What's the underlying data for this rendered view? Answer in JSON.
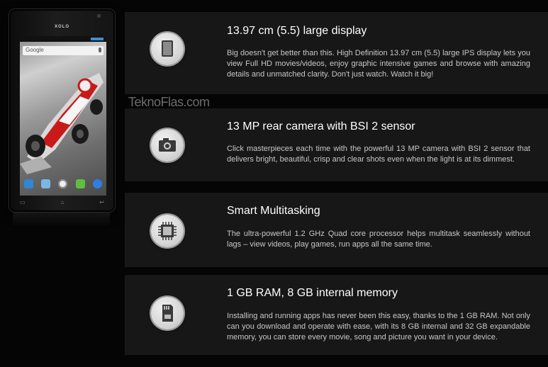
{
  "phone": {
    "brand": "XOLO",
    "search_label": "Google",
    "softkeys": [
      "▭",
      "⌂",
      "↩"
    ]
  },
  "watermark": "TeknoFlas.com",
  "features": [
    {
      "icon": "display-icon",
      "title": "13.97 cm (5.5) large display",
      "description": "Big doesn't get better than this. High Definition 13.97 cm (5.5) large IPS display lets you view Full HD movies/videos, enjoy graphic intensive games and browse with amazing details and unmatched clarity. Don't just watch. Watch it big!"
    },
    {
      "icon": "camera-icon",
      "title": "13 MP rear camera with BSI 2 sensor",
      "description": "Click masterpieces each time with the powerful 13 MP camera with BSI 2 sensor that delivers bright, beautiful, crisp and clear shots even when the light is at its dimmest."
    },
    {
      "icon": "processor-chip-icon",
      "title": "Smart Multitasking",
      "description": "The ultra-powerful 1.2 GHz Quad core processor helps multitask seamlessly without lags – view videos, play games, run apps all the same time."
    },
    {
      "icon": "memory-card-icon",
      "title": "1 GB RAM, 8 GB internal memory",
      "description": "Installing and running apps has never been this easy, thanks to the 1 GB RAM. Not only can you download and operate with ease, with its 8 GB internal and 32 GB expandable memory, you can store every movie, song and picture you want in your device."
    }
  ]
}
